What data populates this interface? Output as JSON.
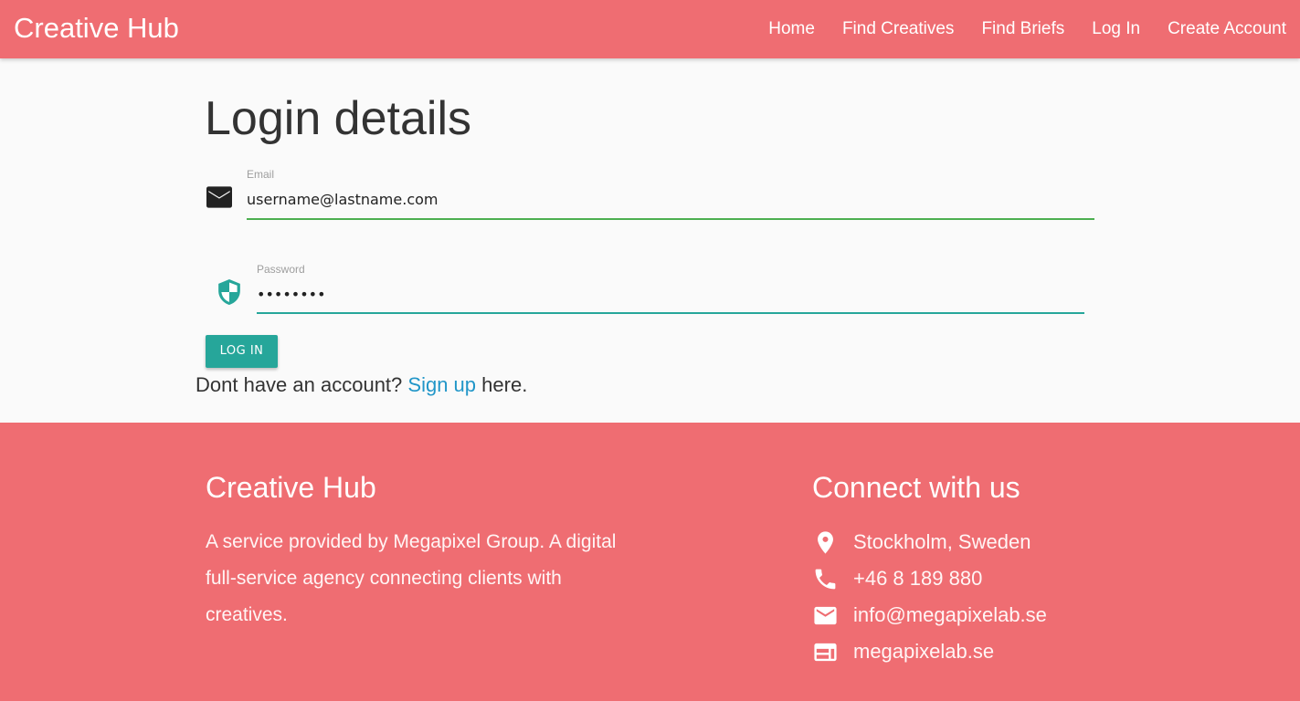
{
  "header": {
    "brand": "Creative Hub",
    "nav": [
      "Home",
      "Find Creatives",
      "Find Briefs",
      "Log In",
      "Create Account"
    ]
  },
  "main": {
    "title": "Login details",
    "email": {
      "label": "Email",
      "value": "username@lastname.com",
      "icon": "mail-icon"
    },
    "password": {
      "label": "Password",
      "value": "password",
      "icon": "shield-icon"
    },
    "login_button": "LOG IN",
    "signup_prefix": "Dont have an account?",
    "signup_link": "Sign up",
    "signup_suffix": "here."
  },
  "footer": {
    "title": "Creative Hub",
    "description": "A service provided by Megapixel Group. A digital full-service agency connecting clients with creatives.",
    "connect_title": "Connect with us",
    "contacts": [
      {
        "icon": "location-pin-icon",
        "text": "Stockholm, Sweden"
      },
      {
        "icon": "phone-icon",
        "text": "+46 8 189 880"
      },
      {
        "icon": "mail-icon",
        "text": "info@megapixelab.se"
      },
      {
        "icon": "web-icon",
        "text": "megapixelab.se"
      }
    ]
  },
  "colors": {
    "brand": "#ef6d72",
    "accent_teal": "#26a69a",
    "email_underline": "#4caf50",
    "link": "#2196c8"
  }
}
